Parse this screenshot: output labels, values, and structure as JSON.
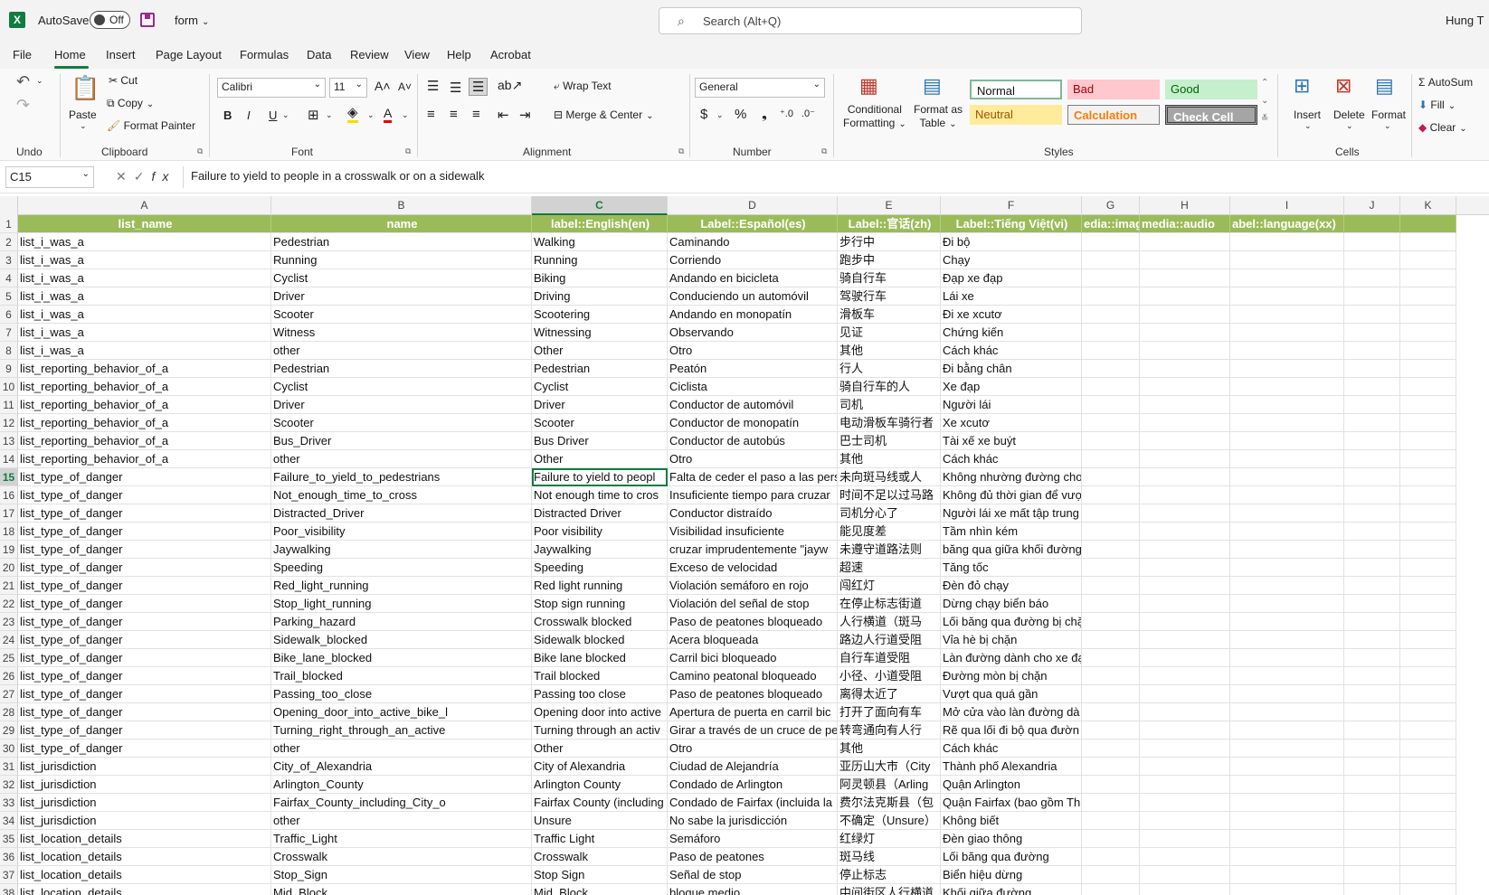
{
  "titlebar": {
    "app_logo": "X",
    "autosave_label": "AutoSave",
    "autosave_state": "Off",
    "file_name": "form",
    "search_placeholder": "Search (Alt+Q)",
    "user_name": "Hung T"
  },
  "menu": {
    "tabs": [
      "File",
      "Home",
      "Insert",
      "Page Layout",
      "Formulas",
      "Data",
      "Review",
      "View",
      "Help",
      "Acrobat"
    ],
    "active": "Home"
  },
  "ribbon": {
    "undo_group": "Undo",
    "clipboard": {
      "label": "Clipboard",
      "paste": "Paste",
      "cut": "Cut",
      "copy": "Copy",
      "format_painter": "Format Painter"
    },
    "font": {
      "label": "Font",
      "family": "Calibri",
      "size": "11"
    },
    "alignment": {
      "label": "Alignment",
      "wrap_text": "Wrap Text",
      "merge_center": "Merge & Center"
    },
    "number": {
      "label": "Number",
      "format": "General"
    },
    "conditional_formatting": [
      "Conditional",
      "Formatting"
    ],
    "format_as_table": [
      "Format as",
      "Table"
    ],
    "styles": {
      "label": "Styles",
      "normal": "Normal",
      "bad": "Bad",
      "good": "Good",
      "neutral": "Neutral",
      "calculation": "Calculation",
      "check_cell": "Check Cell"
    },
    "cells": {
      "label": "Cells",
      "insert": "Insert",
      "delete": "Delete",
      "format": "Format"
    },
    "editing": {
      "autosum": "AutoSum",
      "fill": "Fill",
      "clear": "Clear"
    }
  },
  "formula_bar": {
    "name_box": "C15",
    "formula": "Failure to yield to people in a crosswalk or on a sidewalk"
  },
  "columns": [
    "A",
    "B",
    "C",
    "D",
    "E",
    "F",
    "G",
    "H",
    "I",
    "J",
    "K"
  ],
  "selected_column": "C",
  "header_row": [
    "list_name",
    "name",
    "label::English(en)",
    "Label::Español(es)",
    "Label::官话(zh)",
    "Label::Tiếng Việt(vi)",
    "edia::imag",
    "media::audio",
    "abel::language(xx)"
  ],
  "rows": [
    [
      "2",
      "list_i_was_a",
      "Pedestrian",
      "Walking",
      "Caminando",
      "步行中",
      "Đi bộ"
    ],
    [
      "3",
      "list_i_was_a",
      "Running",
      "Running",
      "Corriendo",
      "跑步中",
      "Chạy"
    ],
    [
      "4",
      "list_i_was_a",
      "Cyclist",
      "Biking",
      "Andando en bicicleta",
      "骑自行车",
      "Đạp xe đạp"
    ],
    [
      "5",
      "list_i_was_a",
      "Driver",
      "Driving",
      "Conduciendo un automóvil",
      "驾驶行车",
      "Lái xe"
    ],
    [
      "6",
      "list_i_was_a",
      "Scooter",
      "Scootering",
      "Andando en monopatín",
      "滑板车",
      "Đi xe xcutơ"
    ],
    [
      "7",
      "list_i_was_a",
      "Witness",
      "Witnessing",
      "Observando",
      "见证",
      "Chứng kiến"
    ],
    [
      "8",
      "list_i_was_a",
      "other",
      "Other",
      "Otro",
      "其他",
      "Cách khác"
    ],
    [
      "9",
      "list_reporting_behavior_of_a",
      "Pedestrian",
      "Pedestrian",
      "Peatón",
      "行人",
      "Đi bằng chân"
    ],
    [
      "10",
      "list_reporting_behavior_of_a",
      "Cyclist",
      "Cyclist",
      "Ciclista",
      "骑自行车的人",
      "Xe đạp"
    ],
    [
      "11",
      "list_reporting_behavior_of_a",
      "Driver",
      "Driver",
      "Conductor de automóvil",
      "司机",
      "Người lái"
    ],
    [
      "12",
      "list_reporting_behavior_of_a",
      "Scooter",
      "Scooter",
      "Conductor de monopatín",
      "电动滑板车骑行者",
      "Xe xcutơ"
    ],
    [
      "13",
      "list_reporting_behavior_of_a",
      "Bus_Driver",
      "Bus Driver",
      "Conductor de autobús",
      "巴士司机",
      "Tài xế xe buýt"
    ],
    [
      "14",
      "list_reporting_behavior_of_a",
      "other",
      "Other",
      "Otro",
      "其他",
      "Cách khác"
    ],
    [
      "15",
      "list_type_of_danger",
      "Failure_to_yield_to_pedestrians",
      "Failure to yield to peopl",
      "Falta de ceder el paso a las pers",
      "未向斑马线或人",
      "Không nhường đường cho"
    ],
    [
      "16",
      "list_type_of_danger",
      "Not_enough_time_to_cross",
      "Not enough time to cros",
      "Insuficiente tiempo para cruzar",
      "时间不足以过马路",
      "Không đủ thời gian để vượ"
    ],
    [
      "17",
      "list_type_of_danger",
      "Distracted_Driver",
      "Distracted Driver",
      "Conductor distraído",
      "司机分心了",
      "Người lái xe mất tập trung"
    ],
    [
      "18",
      "list_type_of_danger",
      "Poor_visibility",
      "Poor visibility",
      "Visibilidad insuficiente",
      "能见度差",
      "Tầm nhìn kém"
    ],
    [
      "19",
      "list_type_of_danger",
      "Jaywalking",
      "Jaywalking",
      "cruzar imprudentemente \"jayw",
      "未遵守道路法则",
      "băng qua giữa khối đường"
    ],
    [
      "20",
      "list_type_of_danger",
      "Speeding",
      "Speeding",
      "Exceso de velocidad",
      "超速",
      "Tăng tốc"
    ],
    [
      "21",
      "list_type_of_danger",
      "Red_light_running",
      "Red light running",
      "Violación semáforo en rojo",
      "闯红灯",
      "Đèn đỏ chạy"
    ],
    [
      "22",
      "list_type_of_danger",
      "Stop_light_running",
      "Stop sign running",
      "Violación del señal de stop",
      "在停止标志街道",
      "Dừng chạy biển báo"
    ],
    [
      "23",
      "list_type_of_danger",
      "Parking_hazard",
      "Crosswalk blocked",
      "Paso de peatones bloqueado",
      "人行横道（斑马",
      "Lối băng qua đường bị chặ"
    ],
    [
      "24",
      "list_type_of_danger",
      "Sidewalk_blocked",
      "Sidewalk blocked",
      "Acera bloqueada",
      "路边人行道受阻",
      "Vỉa hè bị chặn"
    ],
    [
      "25",
      "list_type_of_danger",
      "Bike_lane_blocked",
      "Bike lane blocked",
      "Carril bici bloqueado",
      "自行车道受阻",
      "Làn đường dành cho xe đạ"
    ],
    [
      "26",
      "list_type_of_danger",
      "Trail_blocked",
      "Trail blocked",
      "Camino peatonal bloqueado",
      "小径、小道受阻",
      "Đường mòn bị chặn"
    ],
    [
      "27",
      "list_type_of_danger",
      "Passing_too_close",
      "Passing too close",
      "Paso de peatones bloqueado",
      "离得太近了",
      "Vượt qua quá gần"
    ],
    [
      "28",
      "list_type_of_danger",
      "Opening_door_into_active_bike_l",
      "Opening door into active",
      "Apertura de puerta en carril bic",
      "打开了面向有车",
      "Mở cửa vào làn đường dà"
    ],
    [
      "29",
      "list_type_of_danger",
      "Turning_right_through_an_active",
      "Turning through an activ",
      "Girar a través de un cruce de pe",
      "转弯通向有人行",
      "Rẽ qua lối đi bộ qua đườn"
    ],
    [
      "30",
      "list_type_of_danger",
      "other",
      "Other",
      "Otro",
      "其他",
      "Cách khác"
    ],
    [
      "31",
      "list_jurisdiction",
      "City_of_Alexandria",
      "City of Alexandria",
      "Ciudad de Alejandría",
      "亚历山大市（City",
      "Thành phố Alexandria"
    ],
    [
      "32",
      "list_jurisdiction",
      "Arlington_County",
      "Arlington County",
      "Condado de Arlington",
      "阿灵顿县（Arling",
      "Quận Arlington"
    ],
    [
      "33",
      "list_jurisdiction",
      "Fairfax_County_including_City_o",
      "Fairfax County (including",
      "Condado de Fairfax (incluida la",
      "费尔法克斯县（包",
      "Quận Fairfax (bao gồm Th"
    ],
    [
      "34",
      "list_jurisdiction",
      "other",
      "Unsure",
      "No sabe la jurisdicción",
      "不确定（Unsure）",
      "Không biết"
    ],
    [
      "35",
      "list_location_details",
      "Traffic_Light",
      "Traffic Light",
      "Semáforo",
      "红绿灯",
      "Đèn giao thông"
    ],
    [
      "36",
      "list_location_details",
      "Crosswalk",
      "Crosswalk",
      "Paso de peatones",
      "斑马线",
      "Lối băng qua đường"
    ],
    [
      "37",
      "list_location_details",
      "Stop_Sign",
      "Stop Sign",
      "Señal de stop",
      "停止标志",
      "Biển hiệu dừng"
    ],
    [
      "38",
      "list_location_details",
      "Mid_Block",
      "Mid_Block",
      "bloque medio",
      "中间街区人行横道",
      "Khối giữa đường"
    ]
  ],
  "colors": {
    "excel_green": "#107c41",
    "header_fill": "#9bbb59"
  }
}
